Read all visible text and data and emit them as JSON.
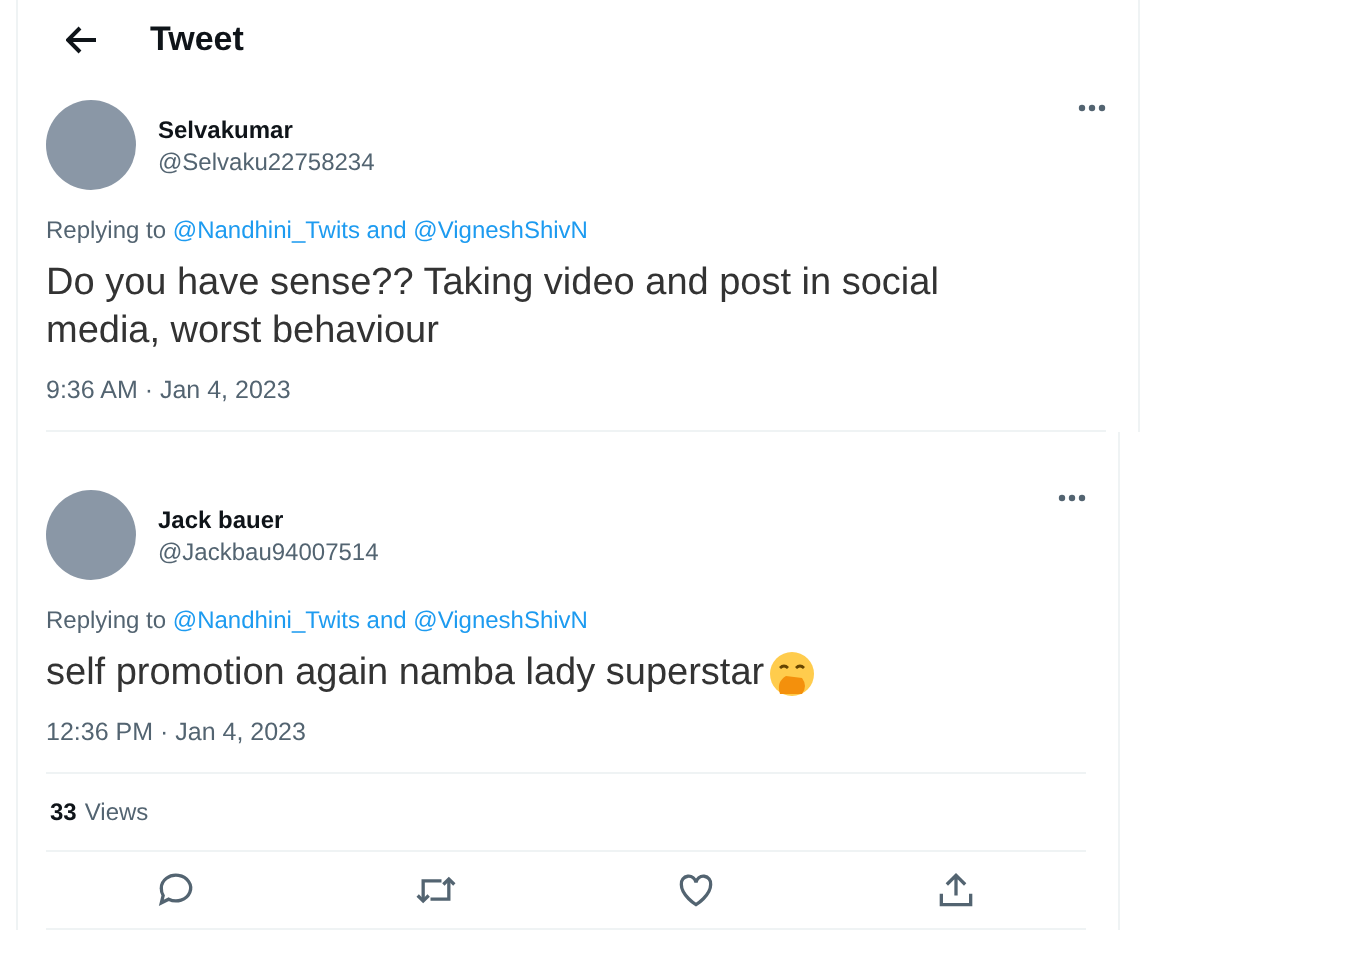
{
  "panels": [
    {
      "header": {
        "title": "Tweet"
      },
      "tweet": {
        "name": "Selvakumar",
        "handle": "@Selvaku22758234",
        "replying_prefix": "Replying to",
        "replying_to": "@Nandhini_Twits and @VigneshShivN",
        "text": "Do you have sense?? Taking video and post in social media, worst behaviour",
        "emoji": false,
        "time": "9:36 AM · Jan 4, 2023"
      }
    },
    {
      "tweet": {
        "name": "Jack bauer",
        "handle": "@Jackbau94007514",
        "replying_prefix": "Replying to",
        "replying_to": "@Nandhini_Twits and @VigneshShivN",
        "text": "self promotion again namba lady superstar",
        "emoji": true,
        "time": "12:36 PM · Jan 4, 2023"
      },
      "views": {
        "count": "33",
        "label": "Views"
      },
      "actions": [
        {
          "kind": "reply"
        },
        {
          "kind": "retweet"
        },
        {
          "kind": "like"
        },
        {
          "kind": "share"
        }
      ]
    }
  ]
}
